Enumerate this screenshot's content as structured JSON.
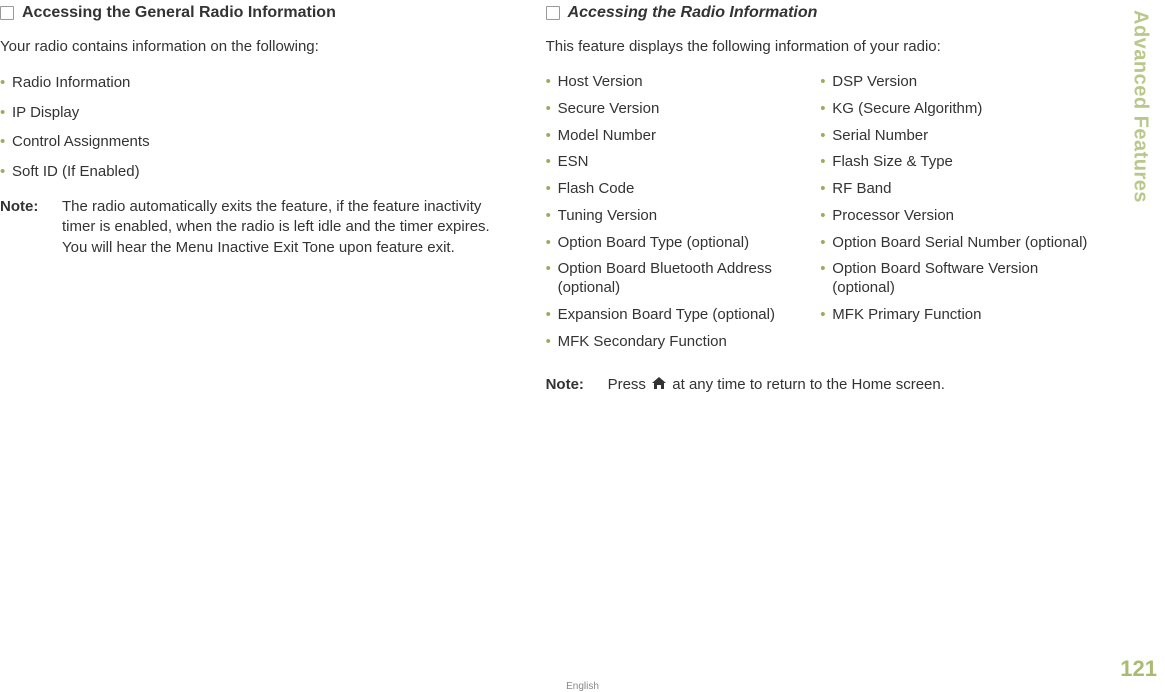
{
  "sidebar": {
    "section_title": "Advanced Features",
    "page_number": "121",
    "language": "English"
  },
  "left": {
    "heading": "Accessing the General Radio Information",
    "intro": "Your radio contains information on the following:",
    "items": [
      "Radio Information",
      "IP Display",
      "Control Assignments",
      "Soft ID (If Enabled)"
    ],
    "note_label": "Note:",
    "note_text": "The radio automatically exits the feature, if the feature inactivity timer is enabled, when the radio is left idle and the timer expires. You will hear the Menu Inactive Exit Tone upon feature exit."
  },
  "right": {
    "heading": "Accessing the Radio Information",
    "intro": "This feature displays the following information of your radio:",
    "col1": [
      "Host Version",
      "Secure Version",
      "Model Number",
      "ESN",
      "Flash Code",
      "Tuning Version",
      "Option Board Type (optional)",
      "Option Board Bluetooth Address (optional)",
      "Expansion Board Type (optional)",
      "MFK Secondary Function"
    ],
    "col2": [
      "DSP Version",
      "KG (Secure Algorithm)",
      "Serial Number",
      "Flash Size & Type",
      "RF Band",
      "Processor Version",
      "Option Board Serial Number (optional)",
      "Option Board Software Version (optional)",
      "MFK Primary Function"
    ],
    "note_label": "Note:",
    "note_prefix": "Press ",
    "note_suffix": " at any time to return to the Home screen."
  }
}
